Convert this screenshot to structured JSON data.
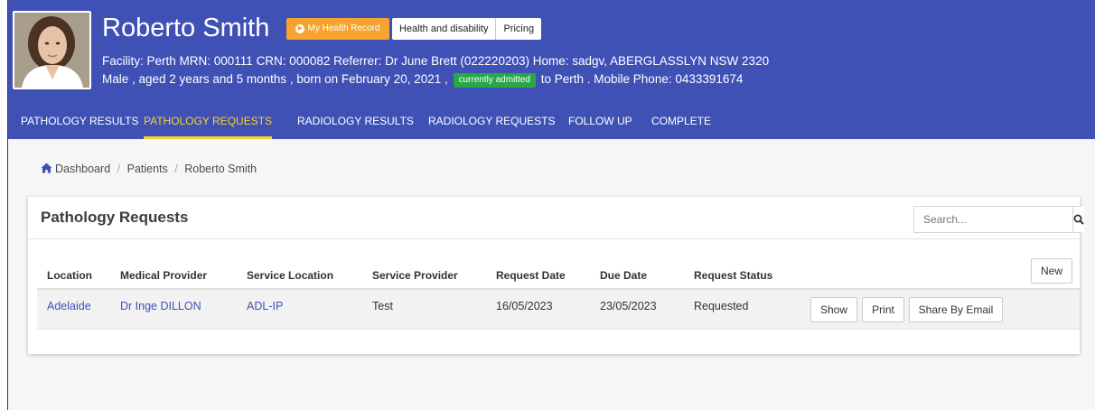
{
  "patient": {
    "name": "Roberto Smith",
    "my_health_record_label": "My Health Record",
    "header_links": [
      "Health and disability",
      "Pricing"
    ],
    "info_line1": "Facility: Perth   MRN: 000111   CRN: 000082   Referrer: Dr June Brett (022220203)   Home: sadgv, ABERGLASSLYN NSW 2320",
    "info_line2_before": "Male , aged 2 years and 5 months , born on February 20, 2021 ,",
    "admitted_badge": "currently admitted",
    "info_line2_after": "to Perth . Mobile Phone: 0433391674"
  },
  "tabs": [
    {
      "label": "PATHOLOGY RESULTS"
    },
    {
      "label": "PATHOLOGY REQUESTS"
    },
    {
      "label": "RADIOLOGY RESULTS"
    },
    {
      "label": "RADIOLOGY REQUESTS"
    },
    {
      "label": "FOLLOW UP"
    },
    {
      "label": "COMPLETE"
    }
  ],
  "active_tab": "PATHOLOGY REQUESTS",
  "breadcrumb": [
    "Dashboard",
    "Patients",
    "Roberto Smith"
  ],
  "panel": {
    "title": "Pathology Requests",
    "search_placeholder": "Search...",
    "new_label": "New",
    "columns": [
      "Location",
      "Medical Provider",
      "Service Location",
      "Service Provider",
      "Request Date",
      "Due Date",
      "Request Status"
    ],
    "rows": [
      {
        "location": "Adelaide",
        "medical_provider": "Dr Inge DILLON",
        "service_location": "ADL-IP",
        "service_provider": "Test",
        "request_date": "16/05/2023",
        "due_date": "23/05/2023",
        "request_status": "Requested",
        "actions": [
          "Show",
          "Print",
          "Share By Email"
        ]
      }
    ]
  },
  "colors": {
    "header_bg": "#3f51b5",
    "active_tab": "#f6d22f",
    "health_record_button": "#f6a32f",
    "admitted_badge": "#27a845",
    "link": "#3f51b5"
  },
  "icons": {
    "my_health_record": "arrow-circle-right-icon",
    "breadcrumb_home": "home-icon",
    "search": "search-icon"
  }
}
